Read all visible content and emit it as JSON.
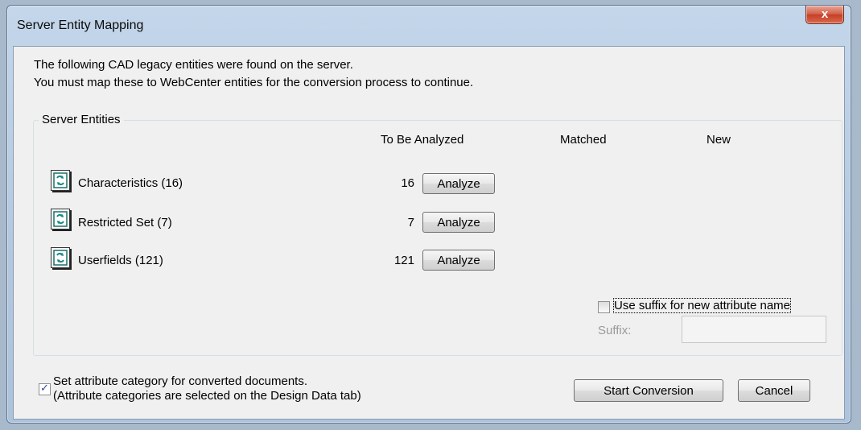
{
  "window": {
    "title": "Server Entity Mapping",
    "close_glyph": "x"
  },
  "intro": {
    "line1": "The following CAD legacy entities were found on the server.",
    "line2": "You must map these to WebCenter entities for the conversion process to continue."
  },
  "group": {
    "legend": "Server Entities",
    "columns": {
      "to_be_analyzed": "To Be Analyzed",
      "matched": "Matched",
      "new": "New"
    },
    "rows": [
      {
        "label": "Characteristics (16)",
        "count": "16",
        "button": "Analyze",
        "icon": "sync-icon"
      },
      {
        "label": "Restricted Set (7)",
        "count": "7",
        "button": "Analyze",
        "icon": "sync-icon"
      },
      {
        "label": "Userfields (121)",
        "count": "121",
        "button": "Analyze",
        "icon": "sync-icon"
      }
    ],
    "use_suffix": {
      "label": "Use suffix for new attribute name",
      "checked": false
    },
    "suffix": {
      "label": "Suffix:",
      "value": ""
    }
  },
  "footer": {
    "set_category": {
      "line1": "Set attribute category for converted documents.",
      "line2": "(Attribute categories are selected on the Design Data tab)",
      "checked": true
    },
    "start_button": "Start Conversion",
    "cancel_button": "Cancel"
  }
}
